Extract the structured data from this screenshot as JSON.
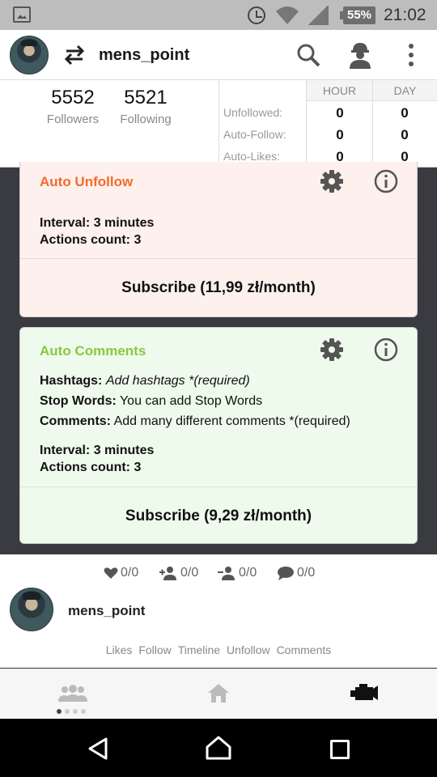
{
  "status_bar": {
    "time": "21:02",
    "battery": "55%"
  },
  "header": {
    "account_name": "mens_point"
  },
  "stats": {
    "followers_count": "5552",
    "followers_label": "Followers",
    "following_count": "5521",
    "following_label": "Following",
    "columns": [
      "HOUR",
      "DAY"
    ],
    "rows": [
      {
        "label": "Unfollowed:",
        "hour": "0",
        "day": "0"
      },
      {
        "label": "Auto-Follow:",
        "hour": "0",
        "day": "0"
      },
      {
        "label": "Auto-Likes:",
        "hour": "0",
        "day": "0"
      }
    ]
  },
  "auto_unfollow": {
    "title": "Auto Unfollow",
    "interval": "Interval: 3 minutes",
    "actions": "Actions count: 3",
    "subscribe": "Subscribe (11,99 zł/month)"
  },
  "auto_comments": {
    "title": "Auto Comments",
    "hashtags_label": "Hashtags:",
    "hashtags_value": "Add hashtags *(required)",
    "stopwords_label": "Stop Words:",
    "stopwords_value": "You can add Stop Words",
    "comments_label": "Comments:",
    "comments_value": "Add many different comments *(required)",
    "interval": "Interval: 3 minutes",
    "actions": "Actions count: 3",
    "subscribe": "Subscribe (9,29 zł/month)"
  },
  "activity": {
    "likes": "0/0",
    "follows": "0/0",
    "unfollows": "0/0",
    "comments": "0/0",
    "user_name": "mens_point",
    "links": [
      "Likes",
      "Follow",
      "Timeline",
      "Unfollow",
      "Comments"
    ]
  },
  "colors": {
    "unfollow_accent": "#f26a2b",
    "comments_accent": "#8cc63f"
  }
}
